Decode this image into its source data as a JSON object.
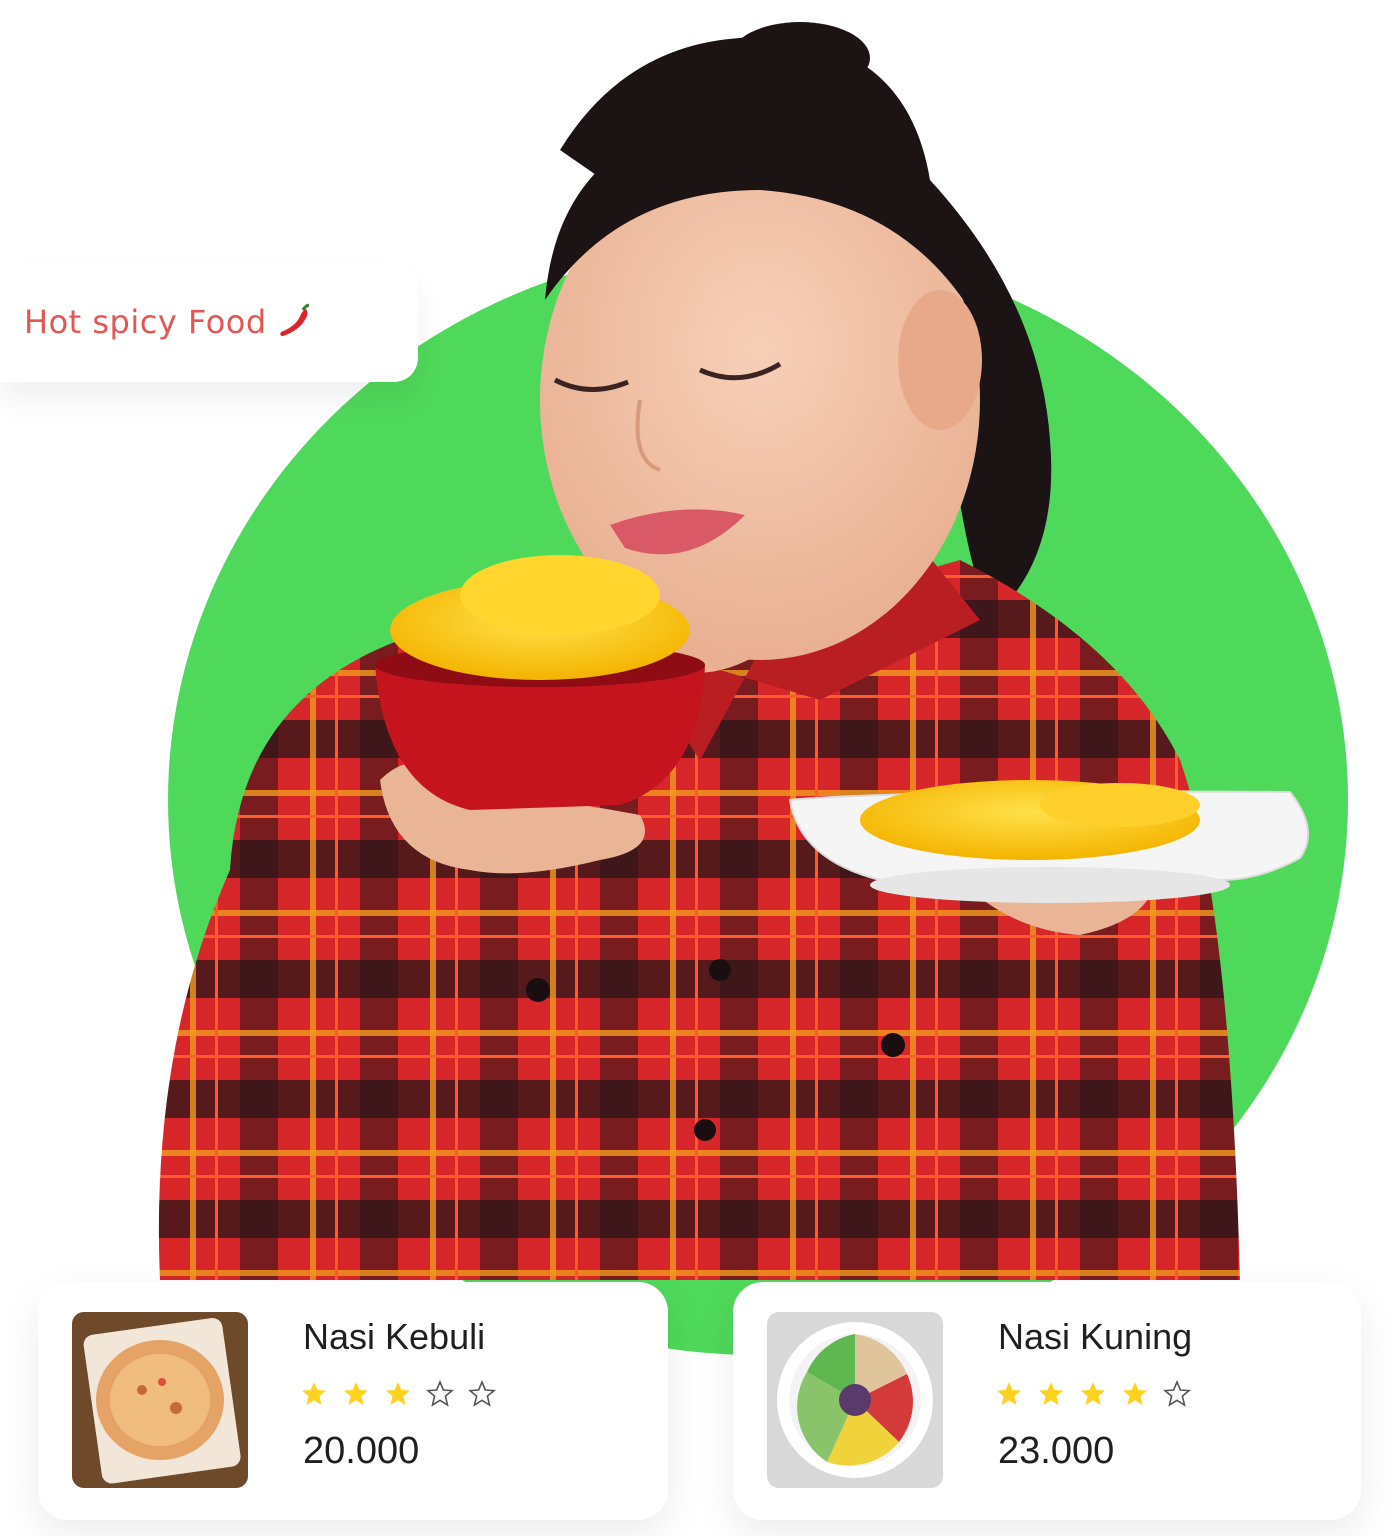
{
  "tag": {
    "text": "Hot spicy Food",
    "icon": "chili-pepper-icon"
  },
  "cards": [
    {
      "name": "Nasi Kebuli",
      "rating": 3,
      "max_rating": 5,
      "price": "20.000"
    },
    {
      "name": "Nasi Kuning",
      "rating": 4,
      "max_rating": 5,
      "price": "23.000"
    }
  ],
  "colors": {
    "circle": "#4fd95a",
    "star_filled": "#ffd21f",
    "tag_text": "#e35656",
    "shirt_red": "#d7262a"
  }
}
